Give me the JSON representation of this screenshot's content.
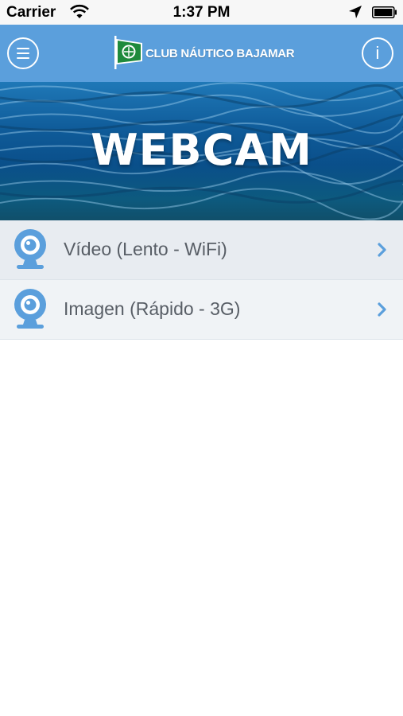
{
  "status_bar": {
    "carrier": "Carrier",
    "time": "1:37 PM",
    "icons": [
      "wifi-icon",
      "location-icon",
      "battery-icon"
    ]
  },
  "nav": {
    "brand": "CLUB NÁUTICO BAJAMAR",
    "menu_icon": "hamburger-menu-icon",
    "info_icon": "info-icon",
    "info_glyph": "i"
  },
  "hero": {
    "title": "WEBCAM"
  },
  "list": {
    "items": [
      {
        "label": "Vídeo (Lento - WiFi)",
        "icon": "webcam-icon"
      },
      {
        "label": "Imagen (Rápido - 3G)",
        "icon": "webcam-icon"
      }
    ]
  },
  "colors": {
    "nav_bar": "#5b9fdc",
    "accent": "#5b9fdc",
    "list_text": "#585e66"
  }
}
